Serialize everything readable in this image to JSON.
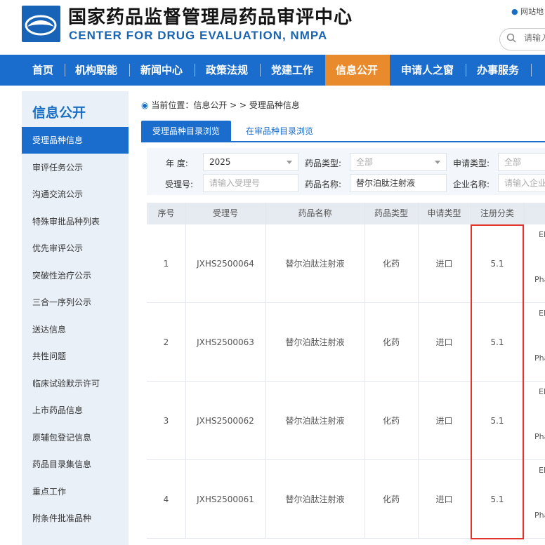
{
  "header": {
    "title_cn": "国家药品监督管理局药品审评中心",
    "title_en": "CENTER FOR DRUG EVALUATION, NMPA",
    "sitemap_label": "网站地",
    "search_placeholder": "请输入"
  },
  "nav": {
    "items": [
      {
        "label": "首页"
      },
      {
        "label": "机构职能"
      },
      {
        "label": "新闻中心"
      },
      {
        "label": "政策法规"
      },
      {
        "label": "党建工作"
      },
      {
        "label": "信息公开",
        "active": true
      },
      {
        "label": "申请人之窗"
      },
      {
        "label": "办事服务"
      }
    ]
  },
  "sidebar": {
    "title": "信息公开",
    "items": [
      {
        "label": "受理品种信息",
        "active": true
      },
      {
        "label": "审评任务公示"
      },
      {
        "label": "沟通交流公示"
      },
      {
        "label": "特殊审批品种列表"
      },
      {
        "label": "优先审评公示"
      },
      {
        "label": "突破性治疗公示"
      },
      {
        "label": "三合一序列公示"
      },
      {
        "label": "送达信息"
      },
      {
        "label": "共性问题"
      },
      {
        "label": "临床试验默示许可"
      },
      {
        "label": "上市药品信息"
      },
      {
        "label": "原辅包登记信息"
      },
      {
        "label": "药品目录集信息"
      },
      {
        "label": "重点工作"
      },
      {
        "label": "附条件批准品种"
      }
    ]
  },
  "breadcrumb": "当前位置：信息公开 > > 受理品种信息",
  "tabs": [
    {
      "label": "受理品种目录浏览",
      "active": true
    },
    {
      "label": "在审品种目录浏览"
    }
  ],
  "filters": {
    "year_label": "年   度:",
    "year_value": "2025",
    "drug_type_label": "药品类型:",
    "drug_type_value": "全部",
    "apply_type_label": "申请类型:",
    "apply_type_value": "全部",
    "accept_no_label": "受理号:",
    "accept_no_placeholder": "请输入受理号",
    "drug_name_label": "药品名称:",
    "drug_name_value": "替尔泊肽注射液",
    "company_label": "企业名称:",
    "company_placeholder": "请输入企业名"
  },
  "table": {
    "headers": [
      "序号",
      "受理号",
      "药品名称",
      "药品类型",
      "申请类型",
      "注册分类"
    ],
    "rows": [
      {
        "no": "1",
        "accept_no": "JXHS2500064",
        "drug_name": "替尔泊肽注射液",
        "drug_type": "化药",
        "apply_type": "进口",
        "reg_class": "5.1",
        "applicant_a": "El",
        "applicant_b": "Pha"
      },
      {
        "no": "2",
        "accept_no": "JXHS2500063",
        "drug_name": "替尔泊肽注射液",
        "drug_type": "化药",
        "apply_type": "进口",
        "reg_class": "5.1",
        "applicant_a": "El",
        "applicant_b": "Pha"
      },
      {
        "no": "3",
        "accept_no": "JXHS2500062",
        "drug_name": "替尔泊肽注射液",
        "drug_type": "化药",
        "apply_type": "进口",
        "reg_class": "5.1",
        "applicant_a": "El",
        "applicant_b": "Pha"
      },
      {
        "no": "4",
        "accept_no": "JXHS2500061",
        "drug_name": "替尔泊肽注射液",
        "drug_type": "化药",
        "apply_type": "进口",
        "reg_class": "5.1",
        "applicant_a": "El",
        "applicant_b": "Pha"
      }
    ]
  },
  "colors": {
    "brand_blue": "#1a6dcc",
    "active_orange": "#e98a2c",
    "highlight_red": "#e0352b"
  }
}
